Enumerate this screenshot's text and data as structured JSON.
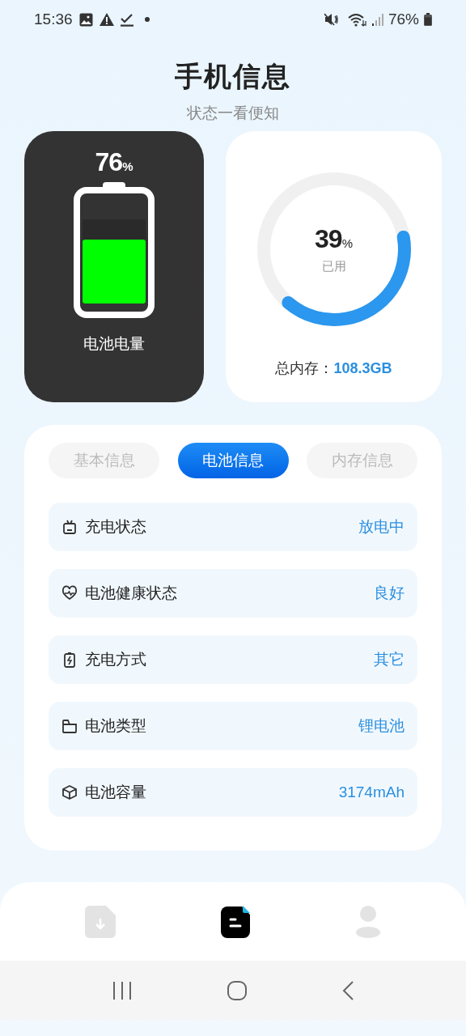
{
  "status_bar": {
    "time": "15:36",
    "battery": "76%"
  },
  "header": {
    "title": "手机信息",
    "subtitle": "状态一看便知"
  },
  "battery_card": {
    "value": "76",
    "unit": "%",
    "level": 0.76,
    "label": "电池电量"
  },
  "memory_card": {
    "value": "39",
    "unit": "%",
    "level": 0.39,
    "caption": "已用",
    "total_label": "总内存：",
    "total_value": "108.3GB"
  },
  "tabs": [
    {
      "label": "基本信息",
      "selected": false
    },
    {
      "label": "电池信息",
      "selected": true
    },
    {
      "label": "内存信息",
      "selected": false
    }
  ],
  "rows": [
    {
      "kind": "status",
      "label": "充电状态",
      "value": "放电中"
    },
    {
      "kind": "health",
      "label": "电池健康状态",
      "value": "良好"
    },
    {
      "kind": "charge",
      "label": "充电方式",
      "value": "其它"
    },
    {
      "kind": "type",
      "label": "电池类型",
      "value": "锂电池"
    },
    {
      "kind": "capacity",
      "label": "电池容量",
      "value": "3174mAh"
    }
  ],
  "bottom_nav": [
    {
      "kind": "download",
      "selected": false
    },
    {
      "kind": "doc",
      "selected": true
    },
    {
      "kind": "user",
      "selected": false
    }
  ]
}
